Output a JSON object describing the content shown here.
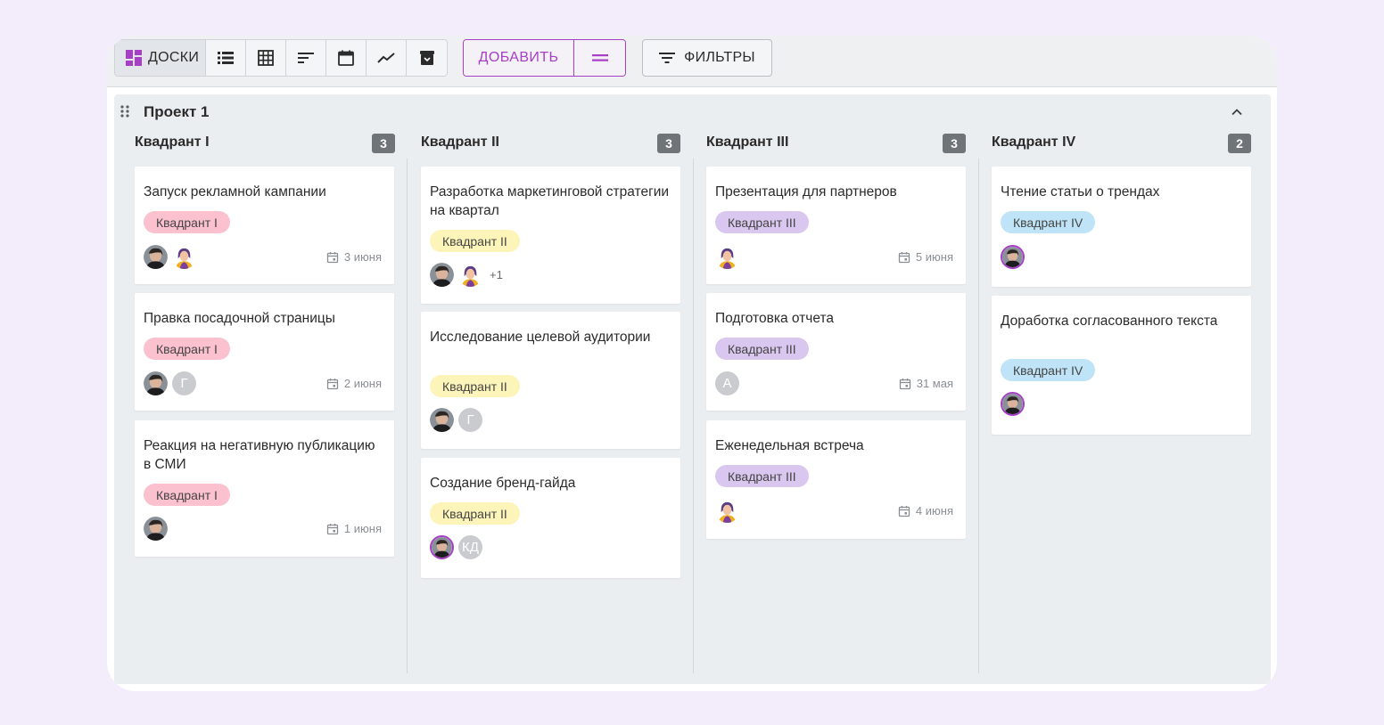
{
  "toolbar": {
    "views": [
      {
        "name": "boards",
        "label": "ДОСКИ",
        "icon": "dashboard-icon",
        "active": true
      },
      {
        "name": "list",
        "icon": "list-icon"
      },
      {
        "name": "table",
        "icon": "grid-icon"
      },
      {
        "name": "gantt",
        "icon": "timeline-icon"
      },
      {
        "name": "calendar",
        "icon": "calendar-icon"
      },
      {
        "name": "chart",
        "icon": "trend-icon"
      },
      {
        "name": "archive",
        "icon": "archive-icon"
      }
    ],
    "add_label": "ДОБАВИТЬ",
    "filters_label": "ФИЛЬТРЫ",
    "accent": "#a63fc6"
  },
  "project": {
    "title": "Проект 1",
    "columns": [
      {
        "title": "Квадрант I",
        "count": "3",
        "cards": [
          {
            "title": "Запуск рекламной кампании",
            "tag": "Квадрант I",
            "date": "3 июня"
          },
          {
            "title": "Правка посадочной страницы",
            "tag": "Квадрант I",
            "date": "2 июня",
            "initial": "Г"
          },
          {
            "title": "Реакция на негативную публикацию в СМИ",
            "tag": "Квадрант I",
            "date": "1 июня"
          }
        ]
      },
      {
        "title": "Квадрант II",
        "count": "3",
        "cards": [
          {
            "title": "Разработка маркетинговой стратегии на квартал",
            "tag": "Квадрант II",
            "extra": "+1"
          },
          {
            "title": "Исследование целевой аудитории",
            "tag": "Квадрант II",
            "initial": "Г"
          },
          {
            "title": "Создание бренд-гайда",
            "tag": "Квадрант II",
            "initial": "КД"
          }
        ]
      },
      {
        "title": "Квадрант III",
        "count": "3",
        "cards": [
          {
            "title": "Презентация для партнеров",
            "tag": "Квадрант III",
            "date": "5 июня"
          },
          {
            "title": "Подготовка отчета",
            "tag": "Квадрант III",
            "date": "31 мая",
            "initial": "А"
          },
          {
            "title": "Еженедельная встреча",
            "tag": "Квадрант III",
            "date": "4 июня"
          }
        ]
      },
      {
        "title": "Квадрант IV",
        "count": "2",
        "cards": [
          {
            "title": "Чтение статьи о трендах",
            "tag": "Квадрант IV"
          },
          {
            "title": "Доработка согласованного текста",
            "tag": "Квадрант IV"
          }
        ]
      }
    ]
  }
}
